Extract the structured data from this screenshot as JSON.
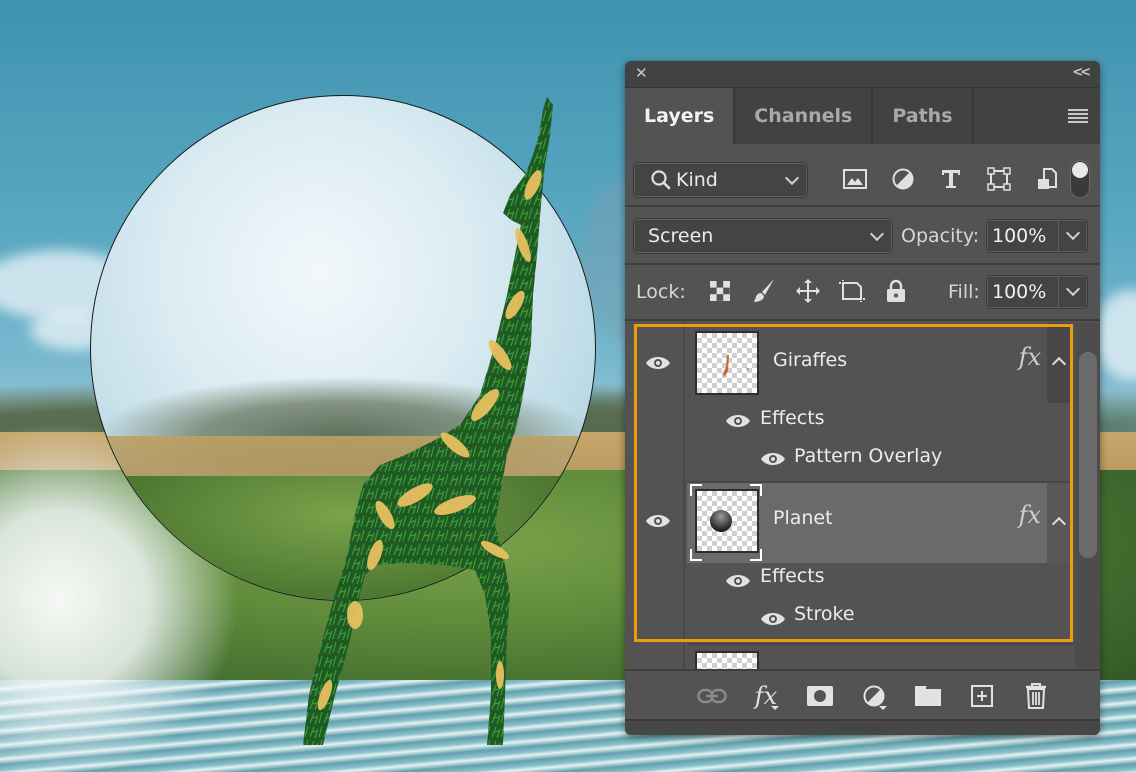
{
  "canvas": {
    "description": "Composite artwork: planet circle over landscape with leaf-textured giraffe silhouette",
    "colors": {
      "sky": "#4a9bb5",
      "planet": "#dcecf3",
      "grass": "#2f6e2a",
      "leaf": "#e8c060"
    }
  },
  "panel": {
    "close_icon": "close-icon",
    "collapse_label": "<<",
    "tabs": [
      {
        "label": "Layers",
        "active": true
      },
      {
        "label": "Channels",
        "active": false
      },
      {
        "label": "Paths",
        "active": false
      }
    ],
    "menu_icon": "hamburger-menu-icon",
    "filter": {
      "kind_label": "Kind",
      "icons": [
        "image-filter-icon",
        "adjustment-filter-icon",
        "type-filter-icon",
        "shape-filter-icon",
        "smart-object-filter-icon"
      ],
      "toggle_on": true
    },
    "blend_mode": "Screen",
    "opacity_label": "Opacity:",
    "opacity_value": "100%",
    "lock_label": "Lock:",
    "lock_icons": [
      "lock-transparent-pixels-icon",
      "lock-image-pixels-icon",
      "lock-position-icon",
      "lock-artboard-icon",
      "lock-all-icon"
    ],
    "fill_label": "Fill:",
    "fill_value": "100%",
    "layers": [
      {
        "name": "Giraffes",
        "visible": true,
        "selected": false,
        "has_fx": true,
        "fx_label": "fx",
        "effects_label": "Effects",
        "effects": [
          "Pattern Overlay"
        ]
      },
      {
        "name": "Planet",
        "visible": true,
        "selected": true,
        "has_fx": true,
        "fx_label": "fx",
        "effects_label": "Effects",
        "effects": [
          "Stroke"
        ]
      }
    ],
    "highlight_color": "#f29a0e",
    "footer_icons": [
      "link-layers-icon",
      "add-layer-style-icon",
      "add-mask-icon",
      "new-fill-adjustment-layer-icon",
      "new-group-icon",
      "new-layer-icon",
      "delete-layer-icon"
    ]
  }
}
